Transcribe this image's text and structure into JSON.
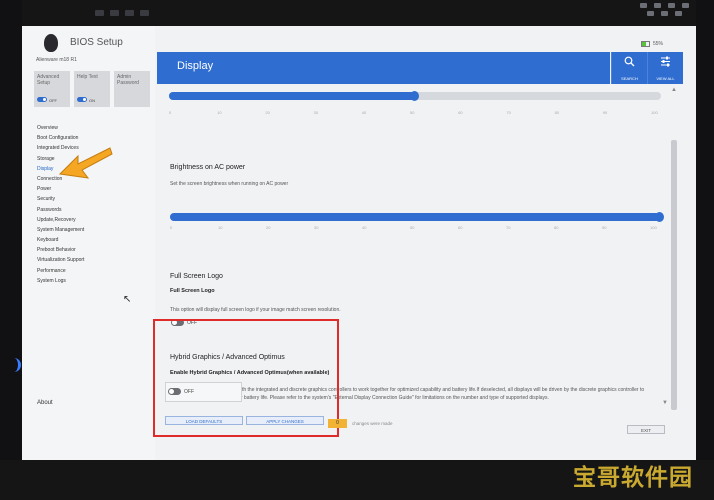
{
  "app": {
    "title": "BIOS Setup",
    "model": "Alienware m18 R1"
  },
  "quick_tiles": [
    {
      "label": "Advanced Setup",
      "state": "OFF"
    },
    {
      "label": "Help Text",
      "state": "ON"
    },
    {
      "label": "Admin Password",
      "state": ""
    }
  ],
  "sidebar": {
    "items": [
      "Overview",
      "Boot Configuration",
      "Integrated Devices",
      "Storage",
      "Display",
      "Connection",
      "Power",
      "Security",
      "Passwords",
      "Update,Recovery",
      "System Management",
      "Keyboard",
      "Preboot Behavior",
      "Virtualization Support",
      "Performance",
      "System Logs"
    ],
    "selected": "Display",
    "about": "About"
  },
  "header": {
    "title": "Display",
    "search_label": "SEARCH",
    "view_all_label": "VIEW ALL",
    "battery_text": "55%"
  },
  "battery_level": 0.55,
  "top_slider": {
    "level": 0.5,
    "ticks": [
      "0",
      "10",
      "20",
      "30",
      "40",
      "50",
      "60",
      "70",
      "80",
      "90",
      "100"
    ]
  },
  "brightness_ac": {
    "title": "Brightness on AC power",
    "description": "Set the screen brightness when running on AC power",
    "level": 1.0,
    "ticks": [
      "0",
      "10",
      "20",
      "30",
      "40",
      "50",
      "60",
      "70",
      "80",
      "90",
      "100"
    ]
  },
  "full_screen_logo": {
    "title": "Full Screen Logo",
    "subtitle": "Full Screen Logo",
    "description": "This option will display full screen logo if your image match screen resolution.",
    "state": "OFF"
  },
  "hybrid_graphics": {
    "title": "Hybrid Graphics / Advanced Optimus",
    "subtitle": "Enable Hybrid Graphics / Advanced Optimus(when available)",
    "description": "If selected, the system allows both the integrated and discrete graphics controllers to work together for optimized capability and battery life.If deselected, all displays will be driven by the discrete graphics controller to prioritize graphics capability over battery life. Please refer to the system's \"External Display Connection Guide\" for limitations on the number and type of supported displays.",
    "state": "OFF"
  },
  "footer": {
    "load_defaults": "LOAD DEFAULTS",
    "apply_changes": "APPLY CHANGES",
    "changes_count": "0",
    "changes_text": "changes were made",
    "exit": "EXIT"
  },
  "watermark": "宝哥软件园",
  "colors": {
    "accent": "#2f6dd0",
    "highlight_box": "#e02b2b",
    "pointer_arrow": "#f5a623"
  }
}
